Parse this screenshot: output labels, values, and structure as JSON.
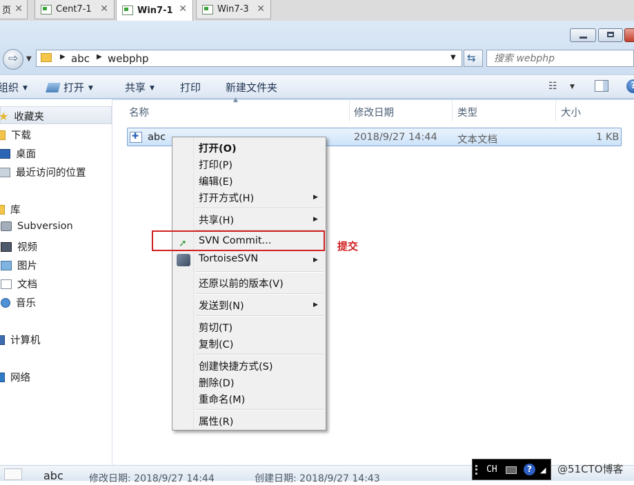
{
  "host_tabs": [
    {
      "label": "页",
      "active": false
    },
    {
      "label": "Cent7-1",
      "active": false
    },
    {
      "label": "Win7-1",
      "active": true
    },
    {
      "label": "Win7-3",
      "active": false
    }
  ],
  "address": {
    "crumbs": [
      "abc",
      "webphp"
    ],
    "search_placeholder": "搜索 webphp"
  },
  "commands": {
    "organize": "组织",
    "open": "打开",
    "share": "共享",
    "print": "打印",
    "new_folder": "新建文件夹"
  },
  "nav": {
    "favorites": "收藏夹",
    "downloads": "下载",
    "desktop": "桌面",
    "recent": "最近访问的位置",
    "libraries": "库",
    "subversion": "Subversion",
    "videos": "视频",
    "pictures": "图片",
    "documents": "文档",
    "music": "音乐",
    "computer": "计算机",
    "network": "网络"
  },
  "columns": {
    "name": "名称",
    "modified": "修改日期",
    "type": "类型",
    "size": "大小"
  },
  "file": {
    "name": "abc",
    "modified": "2018/9/27 14:44",
    "type": "文本文档",
    "size": "1 KB"
  },
  "context_menu": {
    "open": "打开(O)",
    "print": "打印(P)",
    "edit": "编辑(E)",
    "open_with": "打开方式(H)",
    "share": "共享(H)",
    "svn_commit": "SVN Commit...",
    "tortoisesvn": "TortoiseSVN",
    "restore": "还原以前的版本(V)",
    "send_to": "发送到(N)",
    "cut": "剪切(T)",
    "copy": "复制(C)",
    "create_shortcut": "创建快捷方式(S)",
    "delete": "删除(D)",
    "rename": "重命名(M)",
    "properties": "属性(R)"
  },
  "annotation": "提交",
  "details": {
    "name": "abc",
    "modified": "修改日期: 2018/9/27 14:44",
    "created": "创建日期: 2018/9/27 14:43"
  },
  "language_bar": {
    "lang": "CH"
  },
  "watermark": "@51CTO博客",
  "colors": {
    "highlight": "#d21f1f",
    "selection": "#cde3fa"
  }
}
